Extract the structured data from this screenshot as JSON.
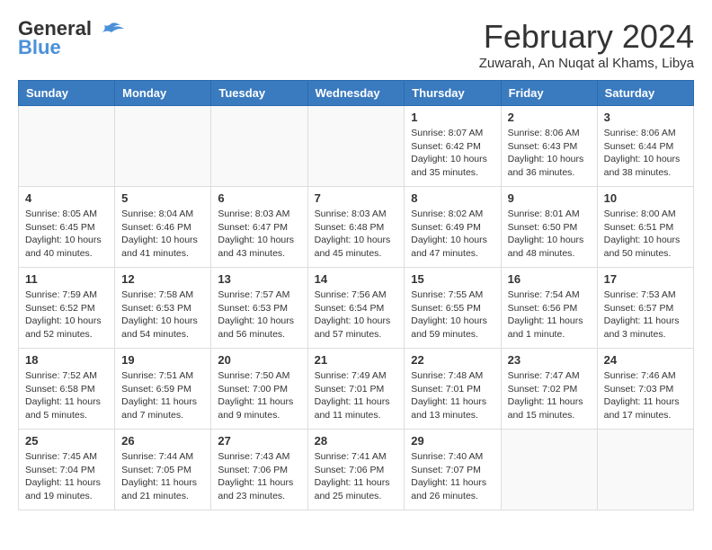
{
  "header": {
    "logo_line1": "General",
    "logo_line2": "Blue",
    "month_title": "February 2024",
    "location": "Zuwarah, An Nuqat al Khams, Libya"
  },
  "weekdays": [
    "Sunday",
    "Monday",
    "Tuesday",
    "Wednesday",
    "Thursday",
    "Friday",
    "Saturday"
  ],
  "weeks": [
    [
      {
        "day": "",
        "info": ""
      },
      {
        "day": "",
        "info": ""
      },
      {
        "day": "",
        "info": ""
      },
      {
        "day": "",
        "info": ""
      },
      {
        "day": "1",
        "info": "Sunrise: 8:07 AM\nSunset: 6:42 PM\nDaylight: 10 hours\nand 35 minutes."
      },
      {
        "day": "2",
        "info": "Sunrise: 8:06 AM\nSunset: 6:43 PM\nDaylight: 10 hours\nand 36 minutes."
      },
      {
        "day": "3",
        "info": "Sunrise: 8:06 AM\nSunset: 6:44 PM\nDaylight: 10 hours\nand 38 minutes."
      }
    ],
    [
      {
        "day": "4",
        "info": "Sunrise: 8:05 AM\nSunset: 6:45 PM\nDaylight: 10 hours\nand 40 minutes."
      },
      {
        "day": "5",
        "info": "Sunrise: 8:04 AM\nSunset: 6:46 PM\nDaylight: 10 hours\nand 41 minutes."
      },
      {
        "day": "6",
        "info": "Sunrise: 8:03 AM\nSunset: 6:47 PM\nDaylight: 10 hours\nand 43 minutes."
      },
      {
        "day": "7",
        "info": "Sunrise: 8:03 AM\nSunset: 6:48 PM\nDaylight: 10 hours\nand 45 minutes."
      },
      {
        "day": "8",
        "info": "Sunrise: 8:02 AM\nSunset: 6:49 PM\nDaylight: 10 hours\nand 47 minutes."
      },
      {
        "day": "9",
        "info": "Sunrise: 8:01 AM\nSunset: 6:50 PM\nDaylight: 10 hours\nand 48 minutes."
      },
      {
        "day": "10",
        "info": "Sunrise: 8:00 AM\nSunset: 6:51 PM\nDaylight: 10 hours\nand 50 minutes."
      }
    ],
    [
      {
        "day": "11",
        "info": "Sunrise: 7:59 AM\nSunset: 6:52 PM\nDaylight: 10 hours\nand 52 minutes."
      },
      {
        "day": "12",
        "info": "Sunrise: 7:58 AM\nSunset: 6:53 PM\nDaylight: 10 hours\nand 54 minutes."
      },
      {
        "day": "13",
        "info": "Sunrise: 7:57 AM\nSunset: 6:53 PM\nDaylight: 10 hours\nand 56 minutes."
      },
      {
        "day": "14",
        "info": "Sunrise: 7:56 AM\nSunset: 6:54 PM\nDaylight: 10 hours\nand 57 minutes."
      },
      {
        "day": "15",
        "info": "Sunrise: 7:55 AM\nSunset: 6:55 PM\nDaylight: 10 hours\nand 59 minutes."
      },
      {
        "day": "16",
        "info": "Sunrise: 7:54 AM\nSunset: 6:56 PM\nDaylight: 11 hours\nand 1 minute."
      },
      {
        "day": "17",
        "info": "Sunrise: 7:53 AM\nSunset: 6:57 PM\nDaylight: 11 hours\nand 3 minutes."
      }
    ],
    [
      {
        "day": "18",
        "info": "Sunrise: 7:52 AM\nSunset: 6:58 PM\nDaylight: 11 hours\nand 5 minutes."
      },
      {
        "day": "19",
        "info": "Sunrise: 7:51 AM\nSunset: 6:59 PM\nDaylight: 11 hours\nand 7 minutes."
      },
      {
        "day": "20",
        "info": "Sunrise: 7:50 AM\nSunset: 7:00 PM\nDaylight: 11 hours\nand 9 minutes."
      },
      {
        "day": "21",
        "info": "Sunrise: 7:49 AM\nSunset: 7:01 PM\nDaylight: 11 hours\nand 11 minutes."
      },
      {
        "day": "22",
        "info": "Sunrise: 7:48 AM\nSunset: 7:01 PM\nDaylight: 11 hours\nand 13 minutes."
      },
      {
        "day": "23",
        "info": "Sunrise: 7:47 AM\nSunset: 7:02 PM\nDaylight: 11 hours\nand 15 minutes."
      },
      {
        "day": "24",
        "info": "Sunrise: 7:46 AM\nSunset: 7:03 PM\nDaylight: 11 hours\nand 17 minutes."
      }
    ],
    [
      {
        "day": "25",
        "info": "Sunrise: 7:45 AM\nSunset: 7:04 PM\nDaylight: 11 hours\nand 19 minutes."
      },
      {
        "day": "26",
        "info": "Sunrise: 7:44 AM\nSunset: 7:05 PM\nDaylight: 11 hours\nand 21 minutes."
      },
      {
        "day": "27",
        "info": "Sunrise: 7:43 AM\nSunset: 7:06 PM\nDaylight: 11 hours\nand 23 minutes."
      },
      {
        "day": "28",
        "info": "Sunrise: 7:41 AM\nSunset: 7:06 PM\nDaylight: 11 hours\nand 25 minutes."
      },
      {
        "day": "29",
        "info": "Sunrise: 7:40 AM\nSunset: 7:07 PM\nDaylight: 11 hours\nand 26 minutes."
      },
      {
        "day": "",
        "info": ""
      },
      {
        "day": "",
        "info": ""
      }
    ]
  ]
}
